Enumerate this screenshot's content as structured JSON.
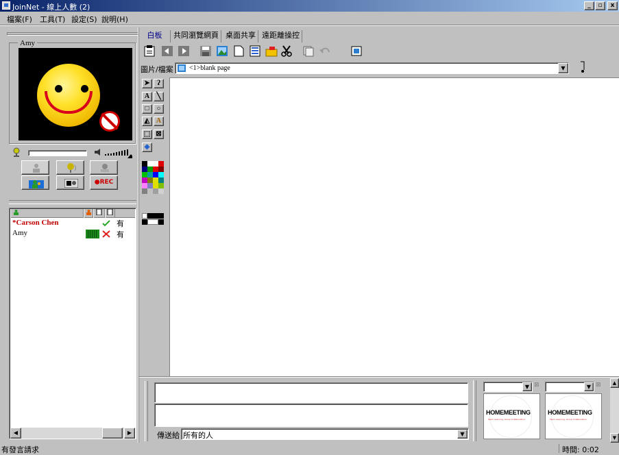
{
  "window": {
    "title": "JoinNet - 線上人數 (2)",
    "min": "_",
    "max": "▫",
    "close": "x"
  },
  "menu": [
    "檔案(F)",
    "工具(T)",
    "設定(S)",
    "說明(H)"
  ],
  "video": {
    "user_label": "Amy"
  },
  "controls": {
    "rec_label": "●REC"
  },
  "participants": {
    "rows": [
      {
        "name": "*Carson Chen",
        "status_icon": "check-icon",
        "answer": "有",
        "color": "#c00000"
      },
      {
        "name": "Amy",
        "status_icon": "cross-icon",
        "answer": "有",
        "color": "#000000"
      }
    ]
  },
  "tabs": [
    "白板",
    "共同瀏覽網頁",
    "桌面共享",
    "遠距離操控"
  ],
  "file": {
    "label": "圖片/檔案",
    "value": "<1>blank page"
  },
  "chat": {
    "send_label": "傳送給",
    "recipient": "所有的人"
  },
  "thumbs": [
    {
      "logo": "HOMEMEETING",
      "tagline": "Team Learning, Group Collaboration."
    },
    {
      "logo": "HOMEMEETING",
      "tagline": "Team Learning, Group Collaboration."
    }
  ],
  "status": {
    "left": "有發言請求",
    "right": "時間: 0:02"
  }
}
